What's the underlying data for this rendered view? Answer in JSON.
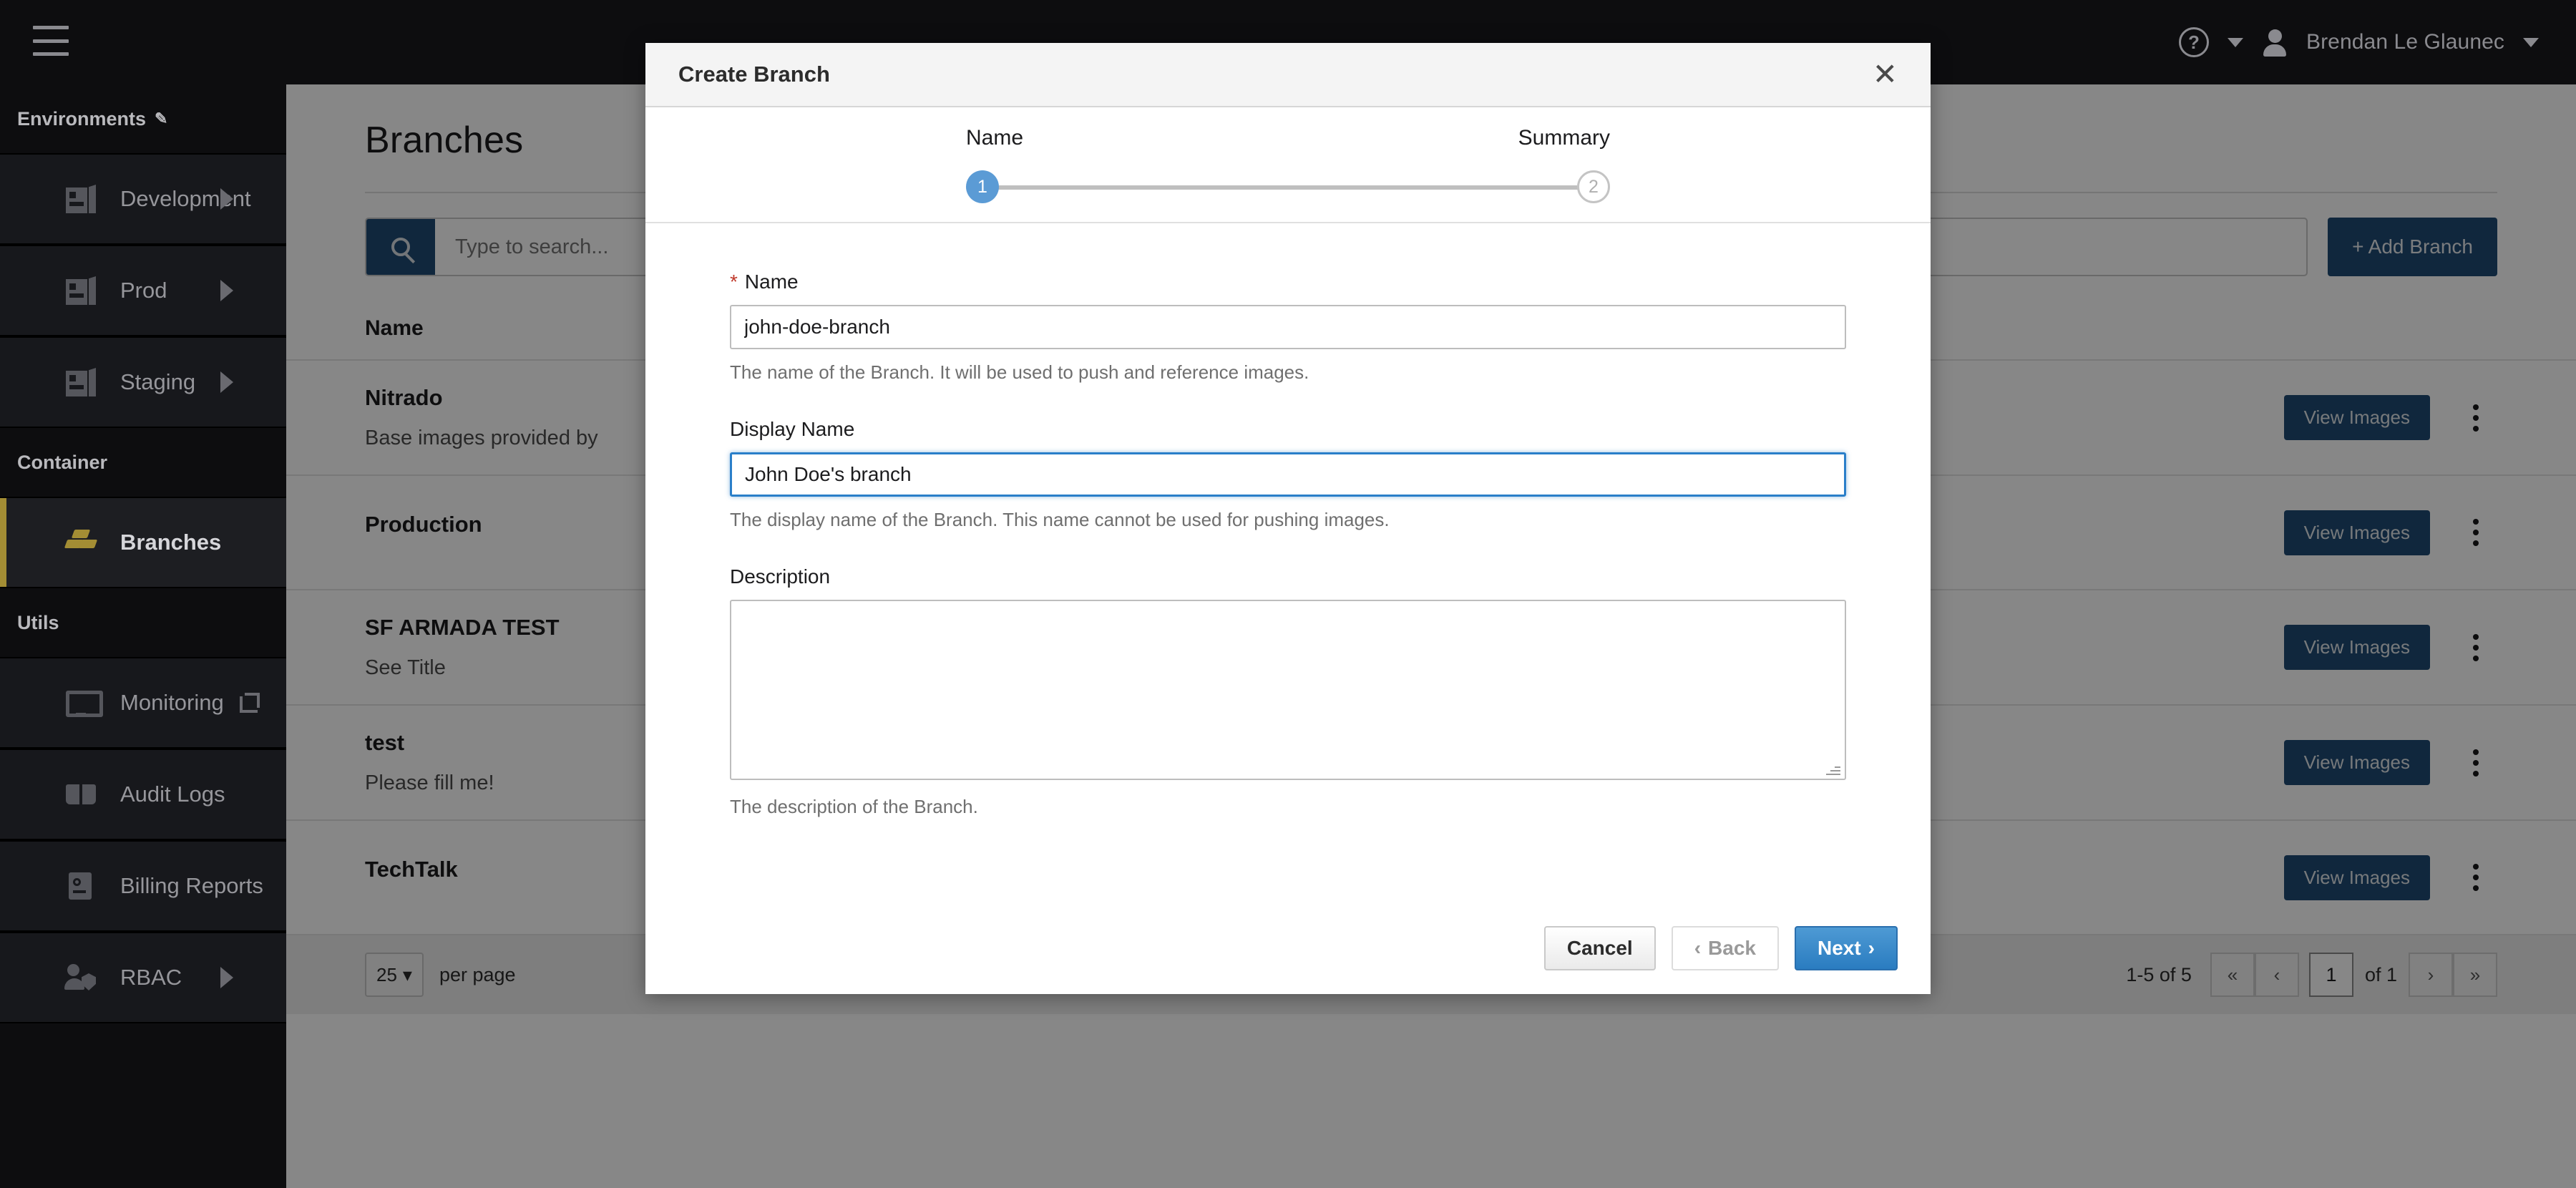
{
  "header": {
    "menu_icon": "hamburger-icon",
    "help_icon": "question-circle-icon",
    "help_caret": "chevron-down-icon",
    "avatar_icon": "user-avatar-icon",
    "username": "Brendan Le Glaunec",
    "user_caret": "chevron-down-icon"
  },
  "sidebar": {
    "sections": [
      {
        "label": "Environments",
        "edit_icon": "pencil-icon",
        "items": [
          {
            "label": "Development",
            "icon": "box-icon",
            "chevron": "chevron-right-icon",
            "active": false
          },
          {
            "label": "Prod",
            "icon": "box-icon",
            "chevron": "chevron-right-icon",
            "active": false
          },
          {
            "label": "Staging",
            "icon": "box-icon",
            "chevron": "chevron-right-icon",
            "active": false
          }
        ]
      },
      {
        "label": "Container",
        "items": [
          {
            "label": "Branches",
            "icon": "branches-icon",
            "active": true
          }
        ]
      },
      {
        "label": "Utils",
        "items": [
          {
            "label": "Monitoring",
            "icon": "monitor-icon",
            "external": "external-link-icon",
            "active": false
          },
          {
            "label": "Audit Logs",
            "icon": "book-icon",
            "active": false
          },
          {
            "label": "Billing Reports",
            "icon": "report-icon",
            "active": false
          },
          {
            "label": "RBAC",
            "icon": "rbac-icon",
            "chevron": "chevron-right-icon",
            "active": false
          }
        ]
      }
    ]
  },
  "main": {
    "page_title": "Branches",
    "search": {
      "placeholder": "Type to search...",
      "value": "",
      "icon": "search-icon"
    },
    "add_branch_label": "+ Add Branch",
    "table": {
      "columns": [
        "Name"
      ],
      "rows": [
        {
          "name": "Nitrado",
          "description": "Base images provided by",
          "action": "View Images",
          "menu": "kebab-menu-icon"
        },
        {
          "name": "Production",
          "description": "",
          "action": "View Images",
          "menu": "kebab-menu-icon"
        },
        {
          "name": "SF ARMADA TEST",
          "description": "See Title",
          "action": "View Images",
          "menu": "kebab-menu-icon"
        },
        {
          "name": "test",
          "description": "Please fill me!",
          "action": "View Images",
          "menu": "kebab-menu-icon"
        },
        {
          "name": "TechTalk",
          "description": "",
          "action": "View Images",
          "menu": "kebab-menu-icon"
        }
      ]
    },
    "pagination": {
      "per_page_value": "25",
      "per_page_label": "per page",
      "range": "1-5 of 5",
      "first_icon": "«",
      "prev_icon": "‹",
      "page_value": "1",
      "of_label": "of 1",
      "next_icon": "›",
      "last_icon": "»"
    }
  },
  "modal": {
    "title": "Create Branch",
    "close_icon": "close-icon",
    "steps": [
      {
        "label": "Name",
        "number": "1",
        "state": "active"
      },
      {
        "label": "Summary",
        "number": "2",
        "state": "pending"
      }
    ],
    "fields": {
      "name": {
        "label": "Name",
        "required_marker": "*",
        "value": "john-doe-branch",
        "hint": "The name of the Branch. It will be used to push and reference images."
      },
      "display_name": {
        "label": "Display Name",
        "value": "John Doe's branch",
        "hint": "The display name of the Branch. This name cannot be used for pushing images.",
        "focused": true
      },
      "description": {
        "label": "Description",
        "value": "",
        "hint": "The description of the Branch."
      }
    },
    "buttons": {
      "cancel": "Cancel",
      "back": "Back",
      "back_icon": "‹",
      "next": "Next",
      "next_icon": "›"
    }
  },
  "colors": {
    "accent_blue": "#1f4a73",
    "primary_blue": "#2a7cc0",
    "step_active": "#5b9bd5",
    "sidebar_active": "#a38d34",
    "required_red": "#c0392b"
  }
}
